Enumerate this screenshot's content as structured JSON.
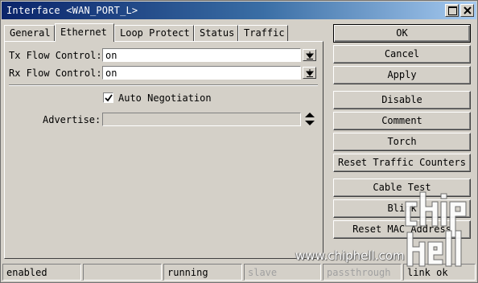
{
  "window": {
    "title": "Interface <WAN_PORT_L>",
    "controls": {
      "maximize_icon": "maximize-icon",
      "close_icon": "close-icon"
    }
  },
  "tabs": [
    {
      "label": "General",
      "active": false
    },
    {
      "label": "Ethernet",
      "active": true
    },
    {
      "label": "Loop Protect",
      "active": false
    },
    {
      "label": "Status",
      "active": false
    },
    {
      "label": "Traffic",
      "active": false
    }
  ],
  "form": {
    "tx_flow_control": {
      "label": "Tx Flow Control:",
      "value": "on"
    },
    "rx_flow_control": {
      "label": "Rx Flow Control:",
      "value": "on"
    },
    "auto_negotiation": {
      "label": "Auto Negotiation",
      "checked": true
    },
    "advertise": {
      "label": "Advertise:",
      "value": ""
    }
  },
  "buttons": {
    "ok": "OK",
    "cancel": "Cancel",
    "apply": "Apply",
    "disable": "Disable",
    "comment": "Comment",
    "torch": "Torch",
    "reset_traffic_counters": "Reset Traffic Counters",
    "cable_test": "Cable Test",
    "blink": "Blink",
    "reset_mac_address": "Reset MAC Address"
  },
  "status": {
    "enabled": "enabled",
    "blank": "",
    "running": "running",
    "slave": "slave",
    "passthrough": "passthrough",
    "link": "link ok"
  },
  "watermark": {
    "url": "www.chiphell.com",
    "logo_text": "chip hell"
  },
  "colors": {
    "titlebar_start": "#0a246a",
    "titlebar_end": "#a6caf0",
    "window_bg": "#d4d0c8",
    "field_bg": "#ffffff",
    "dim_text": "#a0a0a0"
  }
}
